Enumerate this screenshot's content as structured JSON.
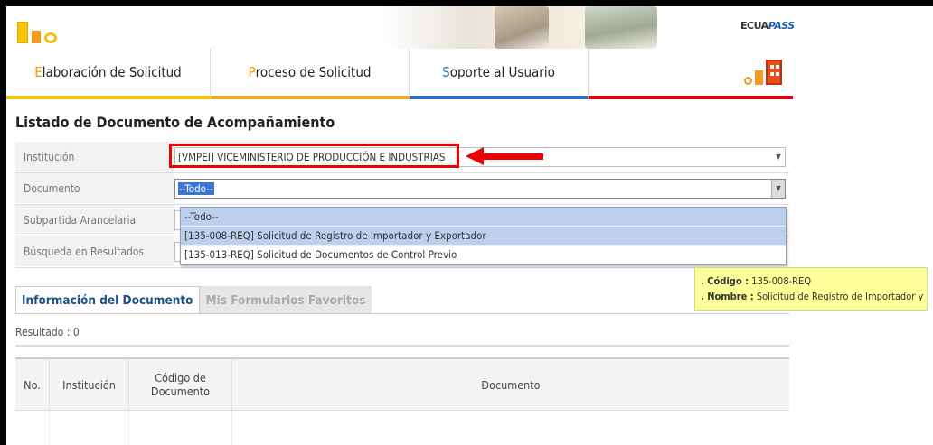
{
  "brand": {
    "name_left": "ECUA",
    "name_right": "PASS"
  },
  "nav": {
    "tabs": [
      {
        "first": "E",
        "rest": "laboración de Solicitud"
      },
      {
        "first": "P",
        "rest": "roceso de Solicitud"
      },
      {
        "first": "S",
        "rest": "oporte al Usuario"
      }
    ]
  },
  "page_title": "Listado de Documento de Acompañamiento",
  "form": {
    "institucion": {
      "label": "Institución",
      "value": "[VMPEI] VICEMINISTERIO DE PRODUCCIÓN E INDUSTRIAS"
    },
    "documento": {
      "label": "Documento",
      "value": "--Todo--"
    },
    "subpartida": {
      "label": "Subpartida Arancelaria"
    },
    "busqueda": {
      "label": "Búsqueda en Resultados"
    }
  },
  "dropdown": {
    "options": [
      "--Todo--",
      "[135-008-REQ] Solicitud de Registro de Importador y Exportador",
      "[135-013-REQ] Solicitud de Documentos de Control Previo"
    ]
  },
  "tabs": {
    "info": "Información del Documento",
    "favoritos": "Mis Formularios Favoritos"
  },
  "result_label": "Resultado : 0",
  "table": {
    "headers": [
      "No.",
      "Institución",
      "Código de Documento",
      "Documento"
    ]
  },
  "tooltip": {
    "codigo_label": ". Código :",
    "codigo_value": " 135-008-REQ",
    "nombre_label": ". Nombre :",
    "nombre_value": " Solicitud de Registro de Importador y Exportador"
  },
  "colors": {
    "accent_orange": "#f39800",
    "accent_blue": "#2d6fc9",
    "accent_red": "#e60012"
  }
}
